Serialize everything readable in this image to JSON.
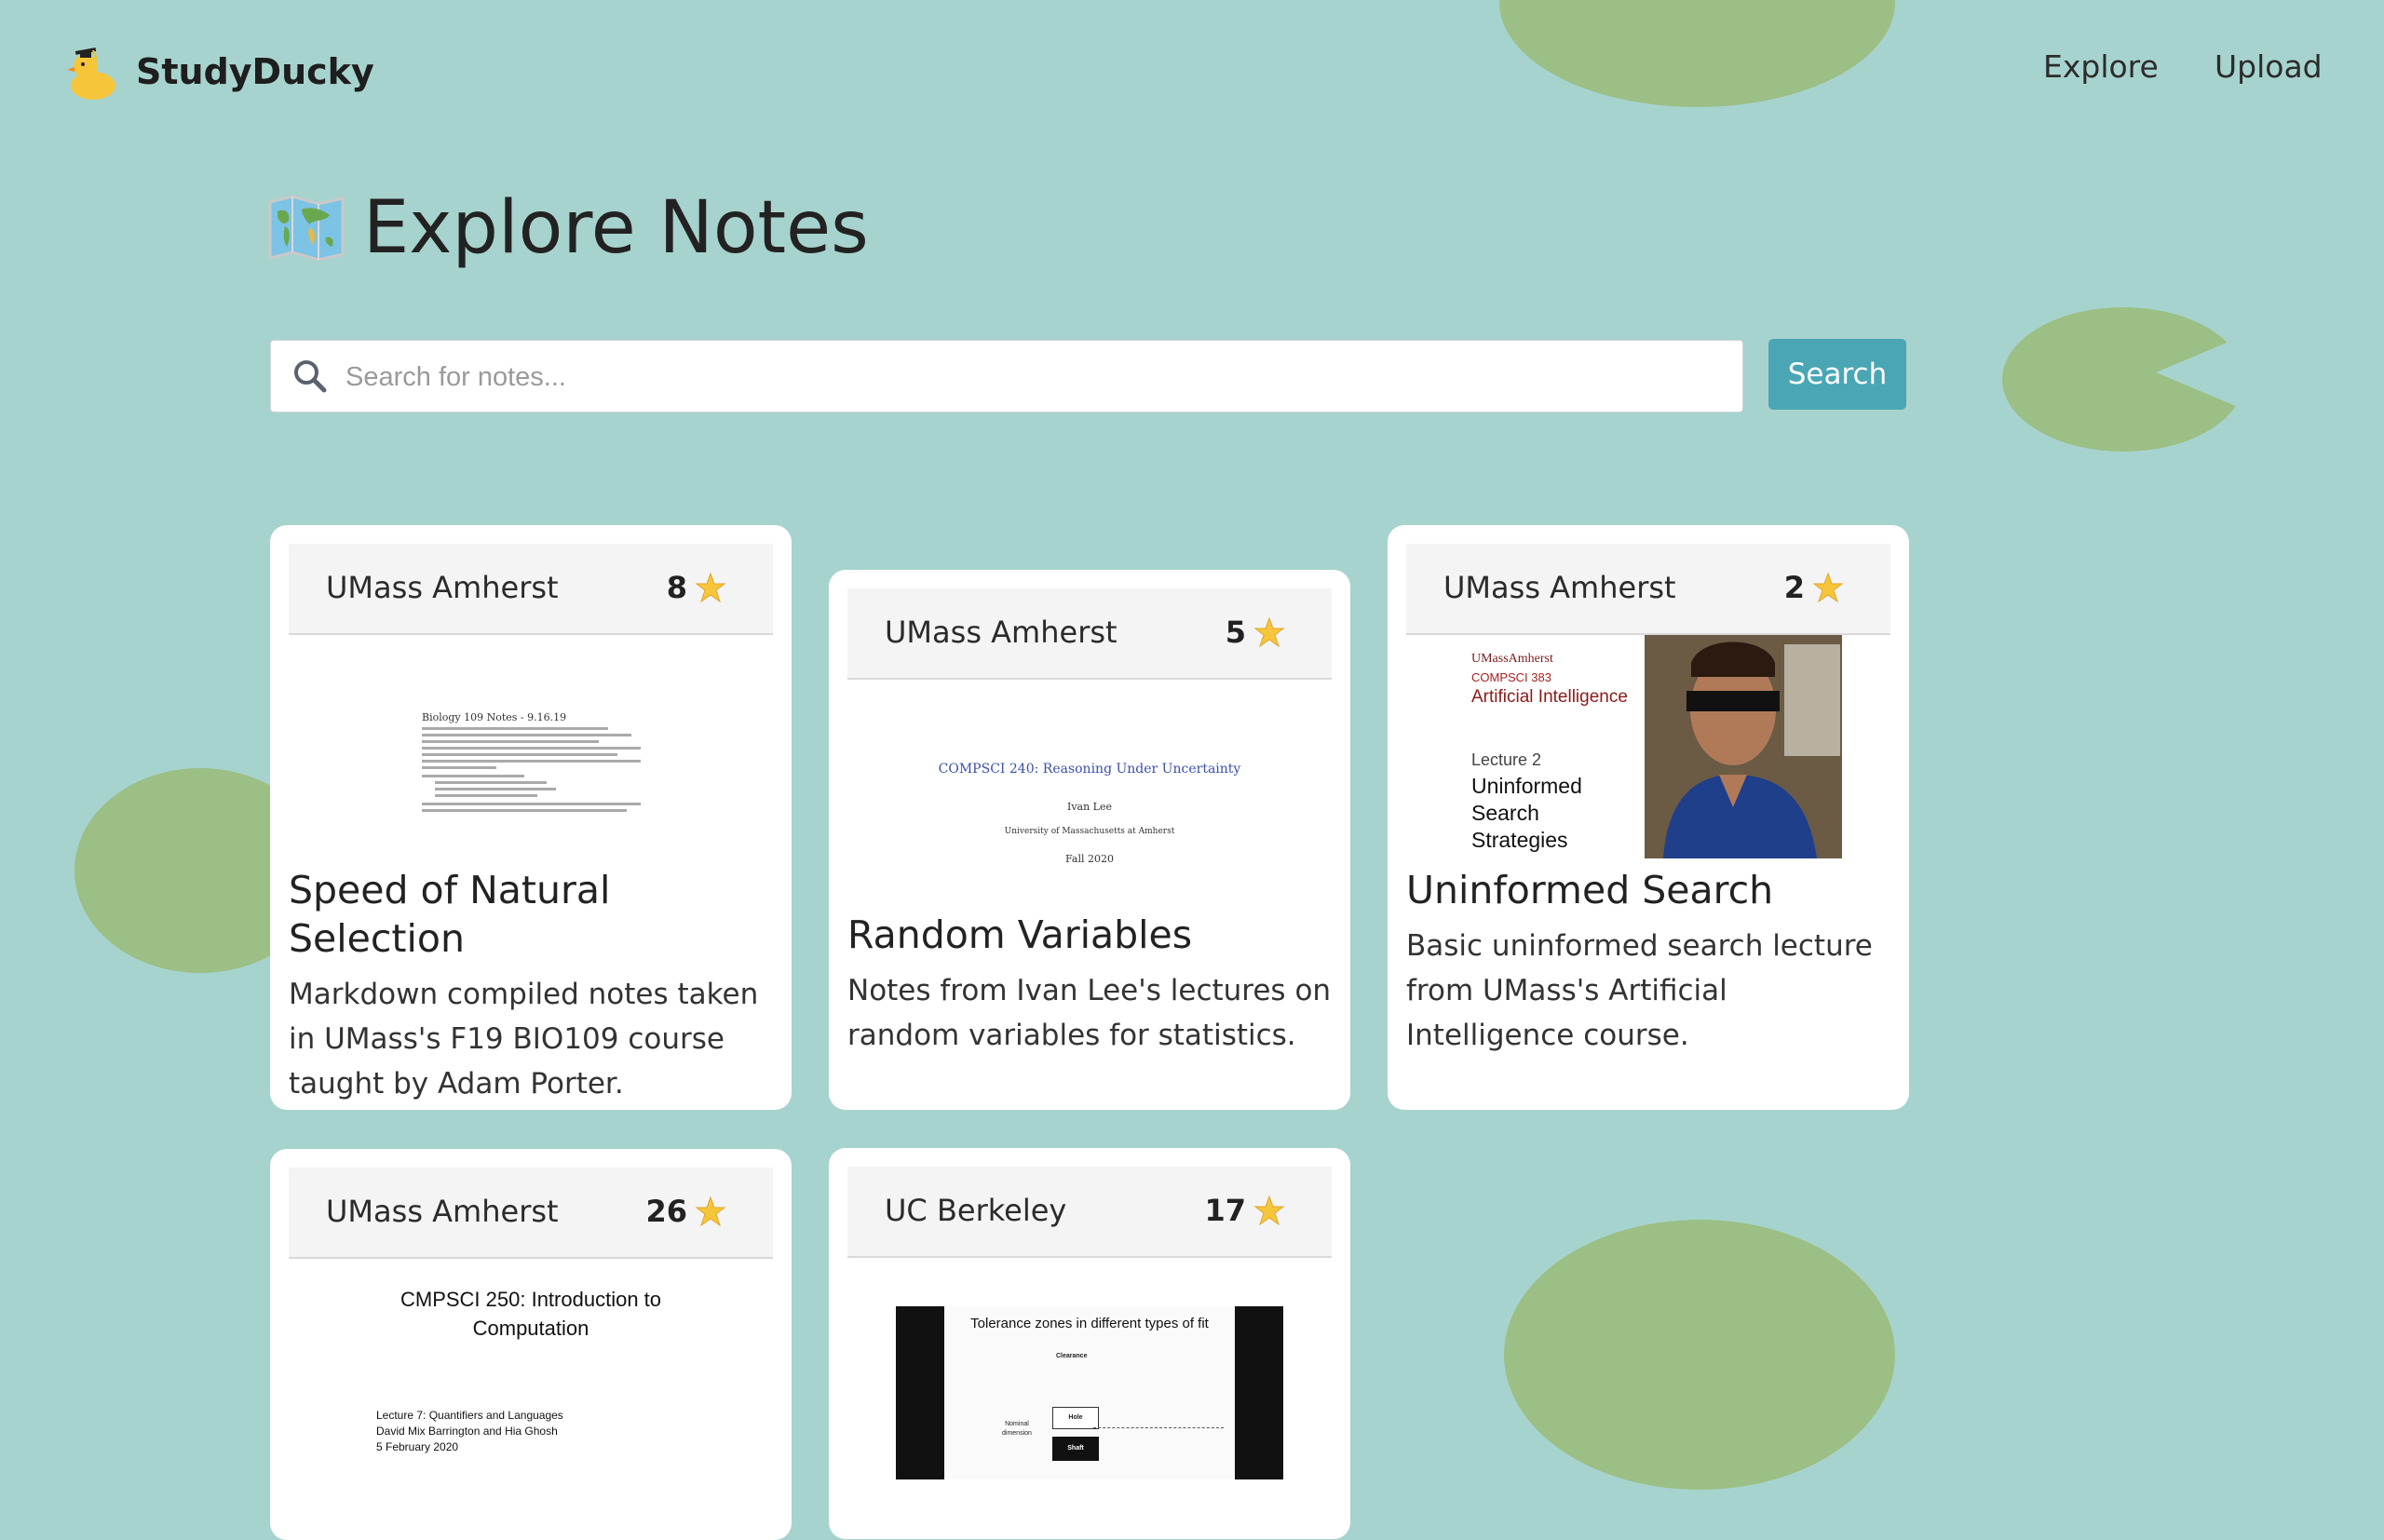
{
  "app": {
    "brand": "StudyDucky"
  },
  "nav": {
    "explore": "Explore",
    "upload": "Upload"
  },
  "page": {
    "title": "Explore Notes"
  },
  "search": {
    "placeholder": "Search for notes...",
    "button": "Search"
  },
  "cards": [
    {
      "school": "UMass Amherst",
      "stars": "8",
      "title": "Speed of Natural Selection",
      "description": "Markdown compiled notes taken in UMass's F19 BIO109 course taught by Adam Porter.",
      "preview": {
        "heading": "Biology 109 Notes - 9.16.19"
      }
    },
    {
      "school": "UMass Amherst",
      "stars": "5",
      "title": "Random Variables",
      "description": "Notes from Ivan Lee's lectures on random variables for statistics.",
      "preview": {
        "course": "COMPSCI 240: Reasoning Under Uncertainty",
        "author": "Ivan Lee",
        "institution": "University of Massachusetts at Amherst",
        "term": "Fall 2020"
      }
    },
    {
      "school": "UMass Amherst",
      "stars": "2",
      "title": "Uninformed Search",
      "description": "Basic uninformed search lecture from UMass's Artificial Intelligence course.",
      "preview": {
        "logo": "UMassAmherst",
        "course": "COMPSCI 383",
        "subject": "Artificial Intelligence",
        "lecture": "Lecture 2",
        "topic1": "Uninformed",
        "topic2": "Search",
        "topic3": "Strategies"
      }
    },
    {
      "school": "UMass Amherst",
      "stars": "26",
      "title": "",
      "description": "",
      "preview": {
        "course1": "CMPSCI 250: Introduction to",
        "course2": "Computation",
        "lecture": "Lecture 7: Quantifiers and Languages",
        "authors": "David Mix Barrington and Hia Ghosh",
        "date": "5 February 2020"
      }
    },
    {
      "school": "UC Berkeley",
      "stars": "17",
      "title": "",
      "description": "",
      "preview": {
        "heading": "Tolerance zones in different types of fit",
        "clearance": "Clearance",
        "hole": "Hole",
        "shaft": "Shaft",
        "nominal": "Nominal",
        "dimension": "dimension"
      }
    }
  ],
  "colors": {
    "background": "#a7d3ce",
    "lilypad": "#9bbf85",
    "accent": "#4aa6b5"
  },
  "icons": {
    "logo": "duck-icon",
    "title": "world-map-icon",
    "search": "search-icon",
    "star": "star-icon"
  }
}
